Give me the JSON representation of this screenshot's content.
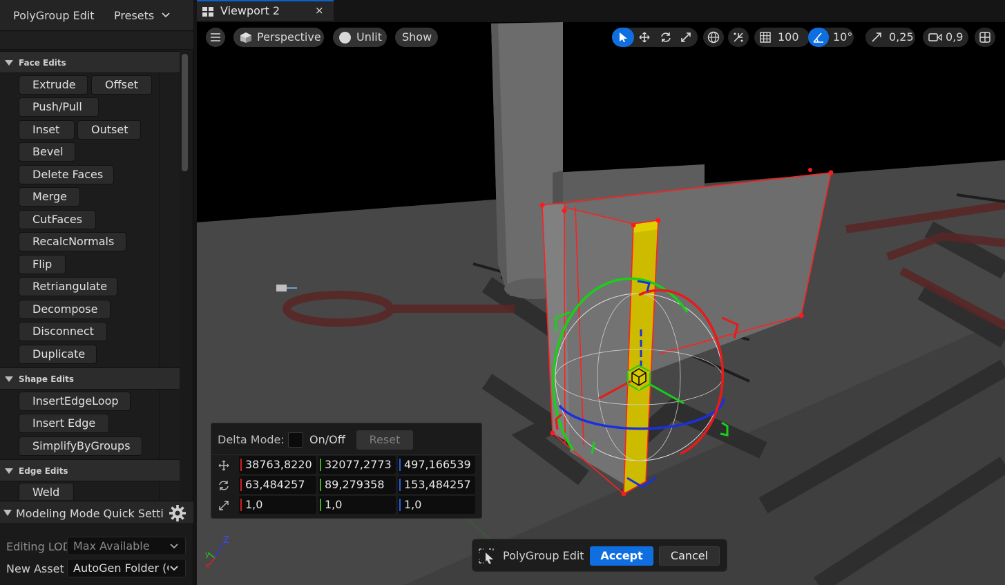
{
  "left_panel": {
    "title": "PolyGroup Edit",
    "presets_label": "Presets",
    "sections": [
      {
        "label": "Face Edits",
        "buttons": [
          "Extrude",
          "Offset",
          "Push/Pull",
          "Inset",
          "Outset",
          "Bevel",
          "Delete Faces",
          "Merge",
          "CutFaces",
          "RecalcNormals",
          "Flip",
          "Retriangulate",
          "Decompose",
          "Disconnect",
          "Duplicate"
        ]
      },
      {
        "label": "Shape Edits",
        "buttons": [
          "InsertEdgeLoop",
          "Insert Edge",
          "SimplifyByGroups"
        ]
      },
      {
        "label": "Edge Edits",
        "buttons": [
          "Weld"
        ]
      }
    ],
    "quick_settings": {
      "label": "Modeling Mode Quick Settings",
      "editing_lod_label": "Editing LOD",
      "editing_lod_value": "Max Available",
      "new_asset_label": "New Asset",
      "new_asset_value": "AutoGen Folder (Global)"
    }
  },
  "viewport": {
    "tab_label": "Viewport 2",
    "tab_close": "×",
    "toolbar": {
      "perspective": "Perspective",
      "unlit": "Unlit",
      "show": "Show",
      "grid_value": "100",
      "angle_value": "10°",
      "scale_value": "0,25",
      "camera_speed": "0,9"
    },
    "delta_panel": {
      "delta_mode_label": "Delta Mode:",
      "on_off_label": "On/Off",
      "reset_label": "Reset",
      "location": [
        "38763,8220",
        "32077,2773",
        "497,166539"
      ],
      "rotation": [
        "63,484257",
        "89,279358",
        "153,484257"
      ],
      "scale": [
        "1,0",
        "1,0",
        "1,0"
      ]
    },
    "accept_bar": {
      "tool_label": "PolyGroup Edit",
      "accept_label": "Accept",
      "cancel_label": "Cancel"
    },
    "axis_indicator": {
      "z": "Z"
    }
  },
  "colors": {
    "accent_blue": "#0f6fe0",
    "axis_x": "#e02020",
    "axis_y": "#20c020",
    "axis_z": "#1a2fe0",
    "selection_yellow": "#d8c800"
  }
}
